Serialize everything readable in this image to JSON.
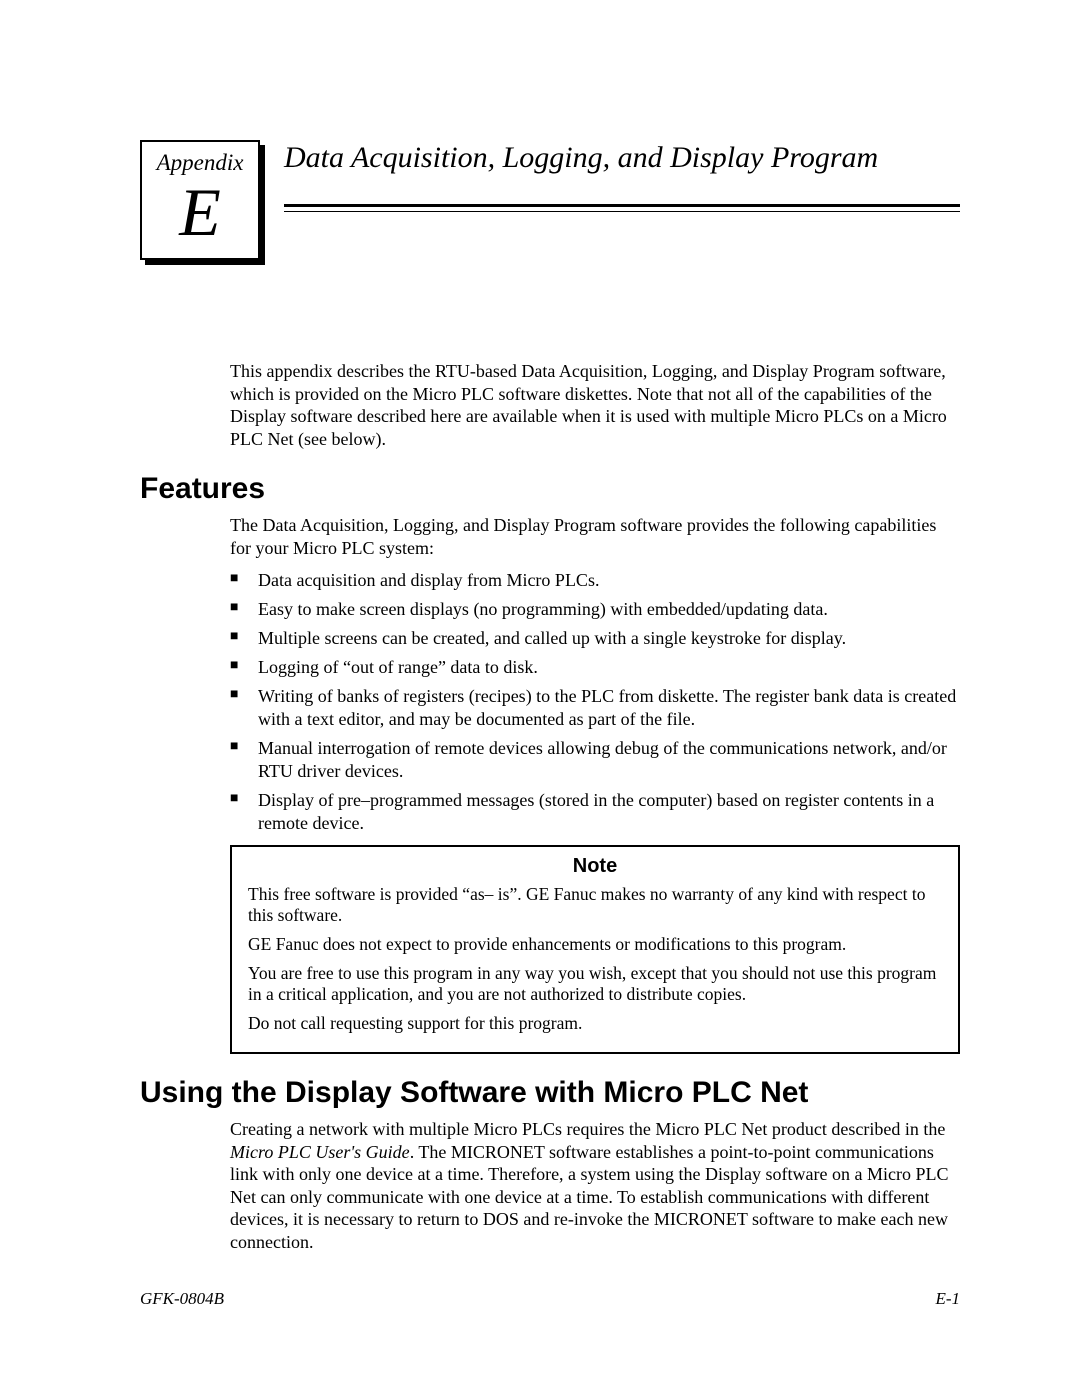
{
  "appendix": {
    "label": "Appendix",
    "letter": "E",
    "title": "Data Acquisition, Logging, and Display Program"
  },
  "intro": "This appendix describes the RTU-based Data Acquisition, Logging, and Display Program software, which is provided on the Micro PLC software diskettes. Note that not all of the capabilities of the Display software described here are available when it is used with multiple Micro PLCs on a Micro PLC Net (see below).",
  "features": {
    "heading": "Features",
    "lead": "The Data Acquisition, Logging, and Display Program software provides the following capabilities for your Micro PLC system:",
    "items": [
      "Data acquisition and display from Micro PLCs.",
      "Easy to make screen displays (no programming) with embedded/updating  data.",
      "Multiple screens can be created, and called up with a single keystroke for display.",
      "Logging of “out of range” data to disk.",
      "Writing of banks of registers (recipes) to the PLC from diskette. The register bank data is created with a text editor, and may be documented as part of the file.",
      "Manual interrogation of remote devices allowing debug of the communications network, and/or RTU driver devices.",
      "Display of pre–programmed messages (stored in the computer) based on register contents in a remote device."
    ]
  },
  "note": {
    "heading": "Note",
    "paras": [
      "This free software is provided “as– is”.  GE Fanuc makes no warranty of any kind with respect to this software.",
      "GE Fanuc does not expect to provide enhancements or modifications to this program.",
      "You are free to use this program in any way you wish, except that you should not use this program in a critical application, and you are not authorized to distribute copies.",
      "Do not call requesting support for this program."
    ]
  },
  "section2": {
    "heading": "Using the Display Software with Micro PLC Net",
    "para_prefix": "Creating a network with multiple Micro PLCs requires the Micro PLC Net product described in the ",
    "para_ital": "Micro PLC User's Guide",
    "para_suffix": ". The MICRONET software establishes a point-to-point communications link with only one device at a time. Therefore, a system using the Display software on a Micro PLC Net can only communicate with one device at a time. To establish communications with different devices, it is necessary to return to DOS and re-invoke the MICRONET software to make each new connection."
  },
  "footer": {
    "left": "GFK-0804B",
    "right": "E-1"
  }
}
